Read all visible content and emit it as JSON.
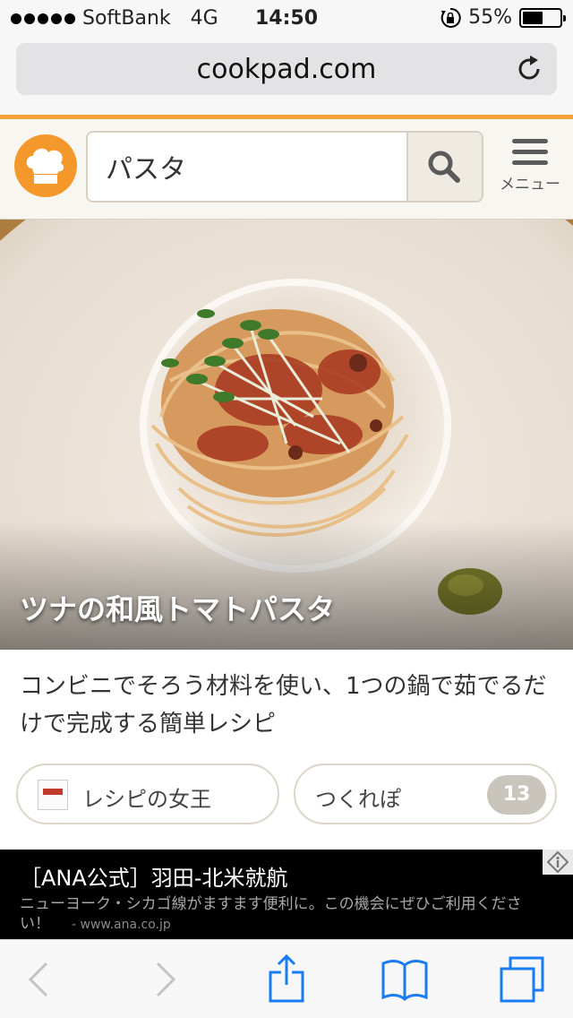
{
  "status_bar": {
    "carrier": "SoftBank",
    "network": "4G",
    "time": "14:50",
    "battery": "55%",
    "battery_level": 0.55
  },
  "browser": {
    "url": "cookpad.com",
    "reload_icon": "reload-icon"
  },
  "header": {
    "logo_icon": "chef-hat-icon",
    "search_value": "パスタ",
    "search_icon": "search-icon",
    "menu_label": "メニュー"
  },
  "recipe": {
    "title": "ツナの和風トマトパスタ",
    "description": "コンビニでそろう材料を使い、1つの鍋で茹でるだけで完成する簡単レシピ",
    "author": "レシピの女王",
    "tsukurepo_label": "つくれぽ",
    "tsukurepo_count": "13"
  },
  "ad": {
    "title": "［ANA公式］羽田-北米就航",
    "text": "ニューヨーク・シカゴ線がますます便利に。この機会にぜひご利用ください！",
    "url": "- www.ana.co.jp"
  },
  "toolbar": {
    "icons": [
      "back-icon",
      "forward-icon",
      "share-icon",
      "bookmarks-icon",
      "tabs-icon"
    ]
  },
  "colors": {
    "brand_orange": "#f5982b",
    "safari_blue": "#1a7cf5"
  }
}
